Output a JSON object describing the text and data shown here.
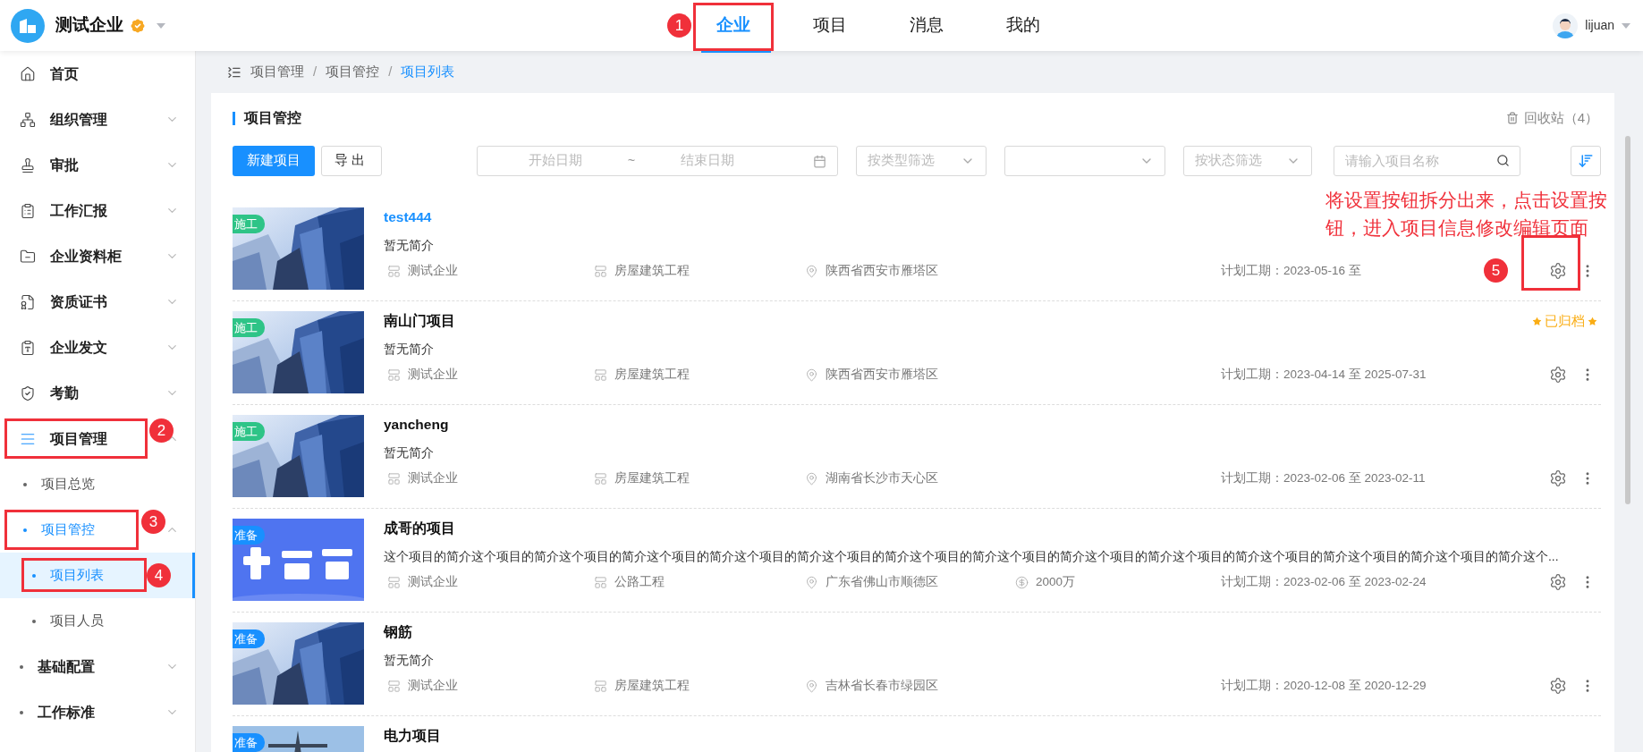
{
  "header": {
    "company": "测试企业",
    "verified": true,
    "tabs": [
      {
        "label": "企业",
        "selected": true,
        "marker": "1"
      },
      {
        "label": "项目",
        "selected": false
      },
      {
        "label": "消息",
        "selected": false
      },
      {
        "label": "我的",
        "selected": false
      }
    ],
    "user": "lijuan"
  },
  "sidebar": {
    "items": [
      {
        "label": "首页",
        "selected": false
      },
      {
        "label": "组织管理",
        "selected": false,
        "expanded": false
      },
      {
        "label": "审批",
        "selected": false,
        "expanded": false
      },
      {
        "label": "工作汇报",
        "selected": false,
        "expanded": false
      },
      {
        "label": "企业资料柜",
        "selected": false,
        "expanded": false
      },
      {
        "label": "资质证书",
        "selected": false,
        "expanded": false
      },
      {
        "label": "企业发文",
        "selected": false,
        "expanded": false
      },
      {
        "label": "考勤",
        "selected": false,
        "expanded": false
      },
      {
        "label": "项目管理",
        "selected": false,
        "expanded": true,
        "marker": "2",
        "children": [
          {
            "label": "项目总览",
            "selected": false
          },
          {
            "label": "项目管控",
            "selected": false,
            "expanded": true,
            "marker": "3",
            "children": [
              {
                "label": "项目列表",
                "selected": true,
                "marker": "4"
              },
              {
                "label": "项目人员",
                "selected": false
              }
            ]
          }
        ]
      },
      {
        "label": "基础配置",
        "selected": false,
        "expanded": false
      },
      {
        "label": "工作标准",
        "selected": false,
        "expanded": false
      }
    ]
  },
  "breadcrumb": [
    {
      "kind": "link",
      "label": "项目管理"
    },
    {
      "kind": "separator",
      "label": "/"
    },
    {
      "kind": "link",
      "label": "项目管控"
    },
    {
      "kind": "separator",
      "label": "/"
    },
    {
      "kind": "current",
      "label": "项目列表"
    }
  ],
  "card": {
    "title": "项目管控",
    "recycle_bin": "回收站（4）"
  },
  "toolbar": {
    "new_button": "新建项目",
    "export_button": "导出",
    "date_range": {
      "start_placeholder": "开始日期",
      "separator": "~",
      "end_placeholder": "结束日期"
    },
    "filters": [
      {
        "kind": "select",
        "placeholder": "按类型筛选"
      },
      {
        "kind": "select"
      },
      {
        "kind": "select",
        "placeholder": "按状态筛选"
      }
    ],
    "search": {
      "placeholder": "请输入项目名称"
    }
  },
  "note": [
    "将设置按钮拆分出来，点击设置按",
    "钮，进入项目信息修改编辑页面"
  ],
  "projects": [
    {
      "tag": "施工",
      "color": "#2ec487",
      "title": "test444",
      "highlighted": true,
      "intro": "暂无简介",
      "company": "测试企业",
      "type": "房屋建筑工程",
      "location": "陕西省西安市雁塔区",
      "plan": "计划工期：2023-05-16 至",
      "gear_marker": "5"
    },
    {
      "tag": "施工",
      "color": "#2ec487",
      "title": "南山门项目",
      "highlighted": false,
      "archived": "已归档",
      "intro": "暂无简介",
      "company": "测试企业",
      "type": "房屋建筑工程",
      "location": "陕西省西安市雁塔区",
      "plan": "计划工期：2023-04-14 至 2025-07-31"
    },
    {
      "tag": "施工",
      "color": "#2ec487",
      "title": "yancheng",
      "highlighted": false,
      "intro": "暂无简介",
      "company": "测试企业",
      "type": "房屋建筑工程",
      "location": "湖南省长沙市天心区",
      "plan": "计划工期：2023-02-06 至 2023-02-11"
    },
    {
      "kind": "banner",
      "tag": "准备",
      "color": "#1890ff",
      "title": "成哥的项目",
      "highlighted": false,
      "intro": "这个项目的简介这个项目的简介这个项目的简介这个项目的简介这个项目的简介这个项目的简介这个项目的简介这个项目的简介这个项目的简介这个项目的简介这个项目的简介这个项目的简介这个项目的简介这个...",
      "company": "测试企业",
      "type": "公路工程",
      "location": "广东省佛山市顺德区",
      "budget": "2000万",
      "plan": "计划工期：2023-02-06 至 2023-02-24"
    },
    {
      "tag": "准备",
      "color": "#1890ff",
      "title": "钢筋",
      "highlighted": false,
      "intro": "暂无简介",
      "company": "测试企业",
      "type": "房屋建筑工程",
      "location": "吉林省长春市绿园区",
      "plan": "计划工期：2020-12-08 至 2020-12-29"
    },
    {
      "kind": "tower",
      "tag": "准备",
      "color": "#1890ff",
      "title": "电力项目",
      "highlighted": false
    }
  ]
}
